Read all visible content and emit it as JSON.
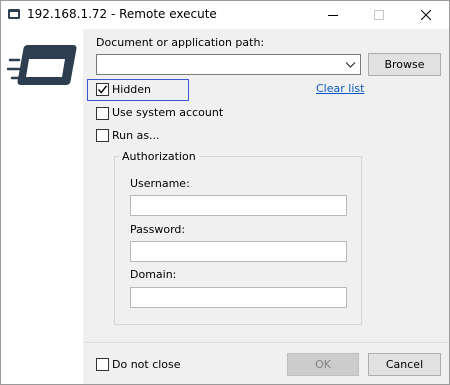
{
  "window": {
    "title": "192.168.1.72 - Remote execute",
    "title_icon": "remote-app-icon",
    "controls": {
      "minimize": "minimize-icon",
      "maximize": "maximize-icon",
      "close": "close-icon"
    }
  },
  "sidebar": {
    "icon": "remote-execute-icon",
    "accent_color": "#2d3e50"
  },
  "path": {
    "label": "Document or application path:",
    "value": "",
    "browse_label": "Browse",
    "clear_label": "Clear list"
  },
  "options": {
    "hidden": {
      "label": "Hidden",
      "checked": true
    },
    "system_account": {
      "label": "Use system account",
      "checked": false
    },
    "run_as": {
      "label": "Run as...",
      "checked": false
    }
  },
  "authorization": {
    "title": "Authorization",
    "username_label": "Username:",
    "username_value": "",
    "password_label": "Password:",
    "password_value": "",
    "domain_label": "Domain:",
    "domain_value": ""
  },
  "footer": {
    "do_not_close": {
      "label": "Do not close",
      "checked": false
    },
    "ok_label": "OK",
    "cancel_label": "Cancel"
  }
}
